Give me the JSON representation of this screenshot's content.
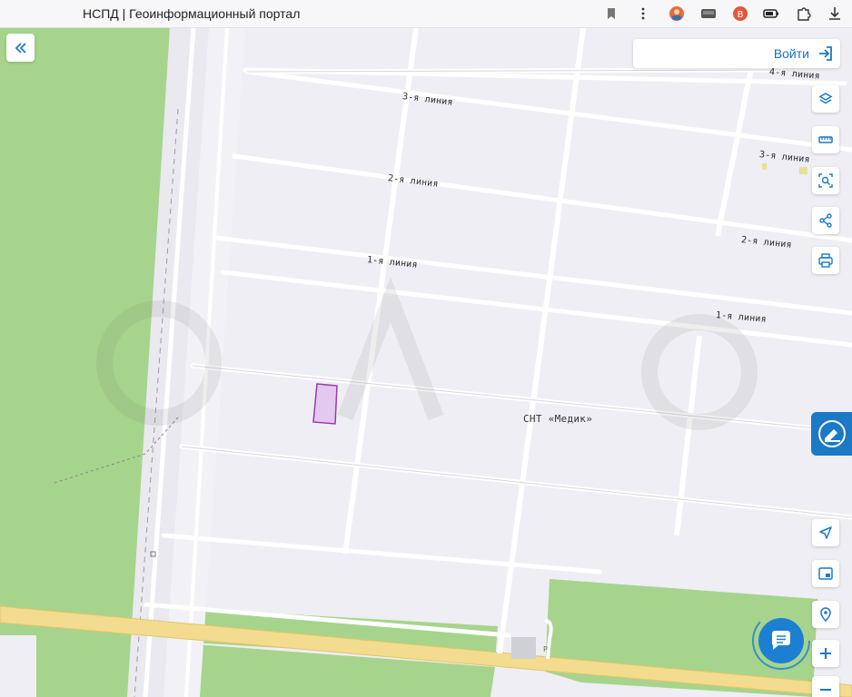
{
  "browser": {
    "tab_title": "НСПД | Геоинформационный портал",
    "icons": [
      "bookmark-icon",
      "more-vertical-icon",
      "avatar-icon",
      "cast-icon",
      "extension-icon",
      "battery-icon",
      "puzzle-icon",
      "download-icon"
    ]
  },
  "header": {
    "login_label": "Войти"
  },
  "map": {
    "roads": [
      {
        "label": "4-я линия"
      },
      {
        "label": "3-я линия"
      },
      {
        "label": "3-я линия"
      },
      {
        "label": "2-я линия"
      },
      {
        "label": "2-я линия"
      },
      {
        "label": "1-я линия"
      },
      {
        "label": "1-я линия"
      }
    ],
    "place_label": "СНТ «Медик»",
    "colors": {
      "background": "#eeeef4",
      "green": "#a6d48c",
      "road_yellow": "#f3dc8f",
      "parcel_fill": "#e3c8ef",
      "parcel_stroke": "#9b3aa8",
      "accent": "#1b79c6"
    }
  },
  "controls": {
    "right_toolbar": [
      "layers-icon",
      "ruler-icon",
      "area-search-icon",
      "share-icon",
      "print-icon"
    ],
    "bottom_toolbar": [
      "locate-icon",
      "minimap-icon",
      "geolocation-icon",
      "zoom-in-icon",
      "zoom-out-icon"
    ],
    "collapse": "chevrons-left-icon",
    "feedback": "feedback-icon",
    "chat": "chat-icon"
  }
}
